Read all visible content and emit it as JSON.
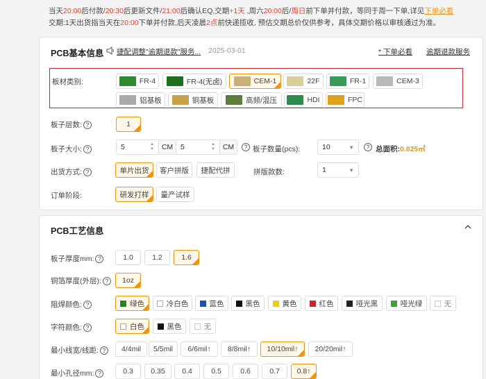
{
  "notice": {
    "p1": "当天",
    "t1": "20:00",
    "p2": "后付款/",
    "t2": "20:30",
    "p3": "后更新文件/",
    "t3": "21:00",
    "p4": "后确认EQ,交期",
    "t4": "+1天",
    "p5": " ,周六",
    "t5": "20:00",
    "p6": "后/",
    "t6": "周日",
    "p7": "前下单并付款，等同于周一下单,详见",
    "link": "下单必看",
    "line2a": "交期:1天出货指当天在",
    "line2t": "20:00",
    "line2b": "下单并付款,后天凌晨",
    "line2t2": "2点",
    "line2c": "前快递揽收, 预估交期总价仅供参考，具体交期价格以审核通过为准。"
  },
  "basic": {
    "title": "PCB基本信息",
    "announce": "捷配调整\"逾期退款\"服务...",
    "date": "2025-03-01",
    "must_read": "* 下单必看",
    "refund": "逾期退款服务",
    "material_label": "板材类别:",
    "materials": [
      {
        "label": "FR-4",
        "color": "#2e8b2e"
      },
      {
        "label": "FR-4(无卤)",
        "color": "#1f6f1f"
      },
      {
        "label": "CEM-1",
        "color": "#c9b27a"
      },
      {
        "label": "22F",
        "color": "#d8cf9a"
      },
      {
        "label": "FR-1",
        "color": "#3a9a5a"
      },
      {
        "label": "CEM-3",
        "color": "#b9b9b9"
      },
      {
        "label": "铝基板",
        "color": "#a9a9a9"
      },
      {
        "label": "铜基板",
        "color": "#c8a24a"
      },
      {
        "label": "高频/混压",
        "color": "#5e7d3a"
      },
      {
        "label": "HDI",
        "color": "#2f8a4f"
      },
      {
        "label": "FPC",
        "color": "#e0a020"
      }
    ],
    "layers_label": "板子层数:",
    "layers_value": "1",
    "size_label": "板子大小:",
    "size_w": "5",
    "size_h": "5",
    "unit": "CM",
    "qty_label": "板子数量(pcs):",
    "qty_value": "10",
    "area_label": "总面积:",
    "area_value": "0.025㎡",
    "ship_label": "出货方式:",
    "ship_opts": [
      "单片出货",
      "客户拼版",
      "捷配代拼"
    ],
    "panel_label": "拼版款数:",
    "panel_value": "1",
    "stage_label": "订单阶段:",
    "stage_opts": [
      "研发打样",
      "量产试样"
    ]
  },
  "process": {
    "title": "PCB工艺信息",
    "collapse_icon": "chevron-up-icon",
    "thickness_label": "板子厚度mm:",
    "thickness_opts": [
      "1.0",
      "1.2",
      "1.6"
    ],
    "copper_label": "铜箔厚度(外层):",
    "copper_value": "1oz",
    "mask_label": "阻焊颜色:",
    "mask_opts": [
      {
        "label": "绿色",
        "color": "#1e8a1e"
      },
      {
        "label": "冷白色",
        "color": "#ffffff"
      },
      {
        "label": "蓝色",
        "color": "#1f4fb0"
      },
      {
        "label": "黑色",
        "color": "#111111"
      },
      {
        "label": "黄色",
        "color": "#f0d000"
      },
      {
        "label": "红色",
        "color": "#c8262c"
      },
      {
        "label": "哑光黑",
        "color": "#222222"
      },
      {
        "label": "哑光绿",
        "color": "#3aa43a"
      },
      {
        "label": "无",
        "color": "#ffffff"
      }
    ],
    "silk_label": "字符颜色:",
    "silk_opts": [
      {
        "label": "白色",
        "color": "#ffffff"
      },
      {
        "label": "黑色",
        "color": "#111111"
      },
      {
        "label": "无",
        "color": "#ffffff"
      }
    ],
    "trace_label": "最小线宽/线距:",
    "trace_opts": [
      "4/4mil",
      "5/5mil",
      "6/6mil↑",
      "8/8mil↑",
      "10/10mil↑",
      "20/20mil↑"
    ],
    "hole_label": "最小孔径mm:",
    "hole_opts": [
      "0.3",
      "0.35",
      "0.4",
      "0.5",
      "0.6",
      "0.7",
      "0.8↑"
    ]
  }
}
